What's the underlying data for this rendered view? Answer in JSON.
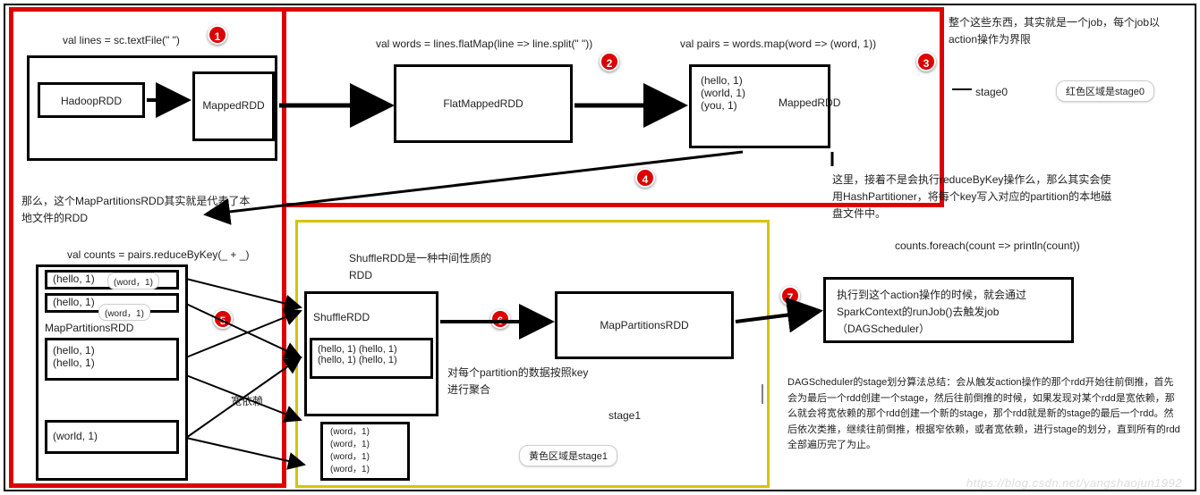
{
  "code": {
    "line1": "val lines = sc.textFile(\" \")",
    "line2": "val words = lines.flatMap(line => line.split(\" \"))",
    "line3": "val pairs = words.map(word => (word, 1))",
    "line4": "val counts = pairs.reduceByKey(_ + _)",
    "line5": "counts.foreach(count => println(count))"
  },
  "rdd": {
    "hadoop": "HadoopRDD",
    "mapped1": "MappedRDD",
    "flatmapped": "FlatMappedRDD",
    "pairs_label": "MappedRDD",
    "pairs_data": "(hello, 1)\n(world, 1)\n(you, 1)",
    "shuffle_title": "ShuffleRDD是一种中间性质的RDD",
    "shuffle": "ShuffleRDD",
    "shuffle_data": "(hello, 1) (hello, 1)\n(hello, 1) (hello, 1)",
    "mappart": "MapPartitionsRDD",
    "mappart_note": "对每个partition的数据按照key进行聚合",
    "word_list": "(word，1)\n(word，1)\n(word，1)\n(word，1)",
    "left_mappart": "MapPartitionsRDD",
    "left_hello": "(hello, 1)\n(hello, 1)",
    "left_hello_pair": "(hello, 1)",
    "left_world": "(world, 1)",
    "wide_dep": "宽依赖",
    "stage1_inner": "stage1"
  },
  "notes": {
    "left_note": "那么，这个MapPartitionsRDD其实就是代表了本地文件的RDD",
    "right_top": "整个这些东西，其实就是一个job，每个job以action操作为界限",
    "stage0_label": "stage0",
    "stage0_badge": "红色区域是stage0",
    "stage1_badge": "黄色区域是stage1",
    "mid_right": "这里，接着不是会执行reduceByKey操作么，那么其实会使用HashPartitioner，将每个key写入对应的partition的本地磁盘文件中。",
    "action_box": "执行到这个action操作的时候，就会通过SparkContext的runJob()去触发job（DAGScheduler）",
    "dag_summary": "DAGScheduler的stage划分算法总结：会从触发action操作的那个rdd开始往前倒推，首先会为最后一个rdd创建一个stage，然后往前倒推的时候，如果发现对某个rdd是宽依赖，那么就会将宽依赖的那个rdd创建一个新的stage，那个rdd就是新的stage的最后一个rdd。然后依次类推，继续往前倒推，根据窄依赖，或者宽依赖，进行stage的划分，直到所有的rdd全部遍历完了为止。"
  },
  "markers": {
    "m1": "1",
    "m2": "2",
    "m3": "3",
    "m4": "4",
    "m5": "5",
    "m6": "6",
    "m7": "7"
  },
  "badges": {
    "word1": "(word，1)",
    "word2": "(word，1)"
  },
  "watermark": "https://blog.csdn.net/yangshaojun1992"
}
